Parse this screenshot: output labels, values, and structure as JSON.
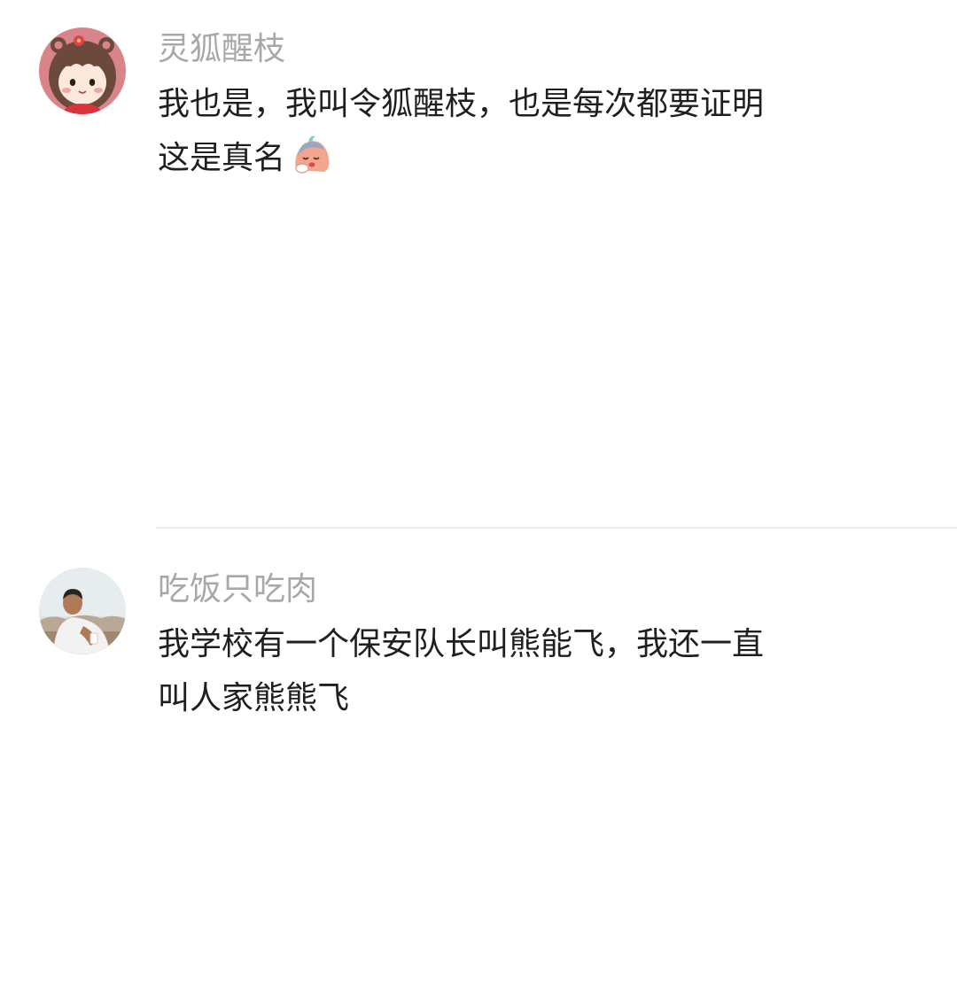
{
  "comments": [
    {
      "username": "灵狐醒枝",
      "text_line_1": "我也是，我叫令狐醒枝，也是每次都要证明",
      "text_line_2": "这是真名",
      "emoji": "sad-pleading-emoji",
      "avatar": "cartoon-girl-avatar"
    },
    {
      "username": "吃饭只吃肉",
      "text_line_1": "我学校有一个保安队长叫熊能飞，我还一直",
      "text_line_2": "叫人家熊熊飞",
      "avatar": "photo-man-avatar"
    }
  ],
  "colors": {
    "username": "#a8a8a8",
    "text": "#1f1f1f",
    "divider": "#ececec"
  }
}
